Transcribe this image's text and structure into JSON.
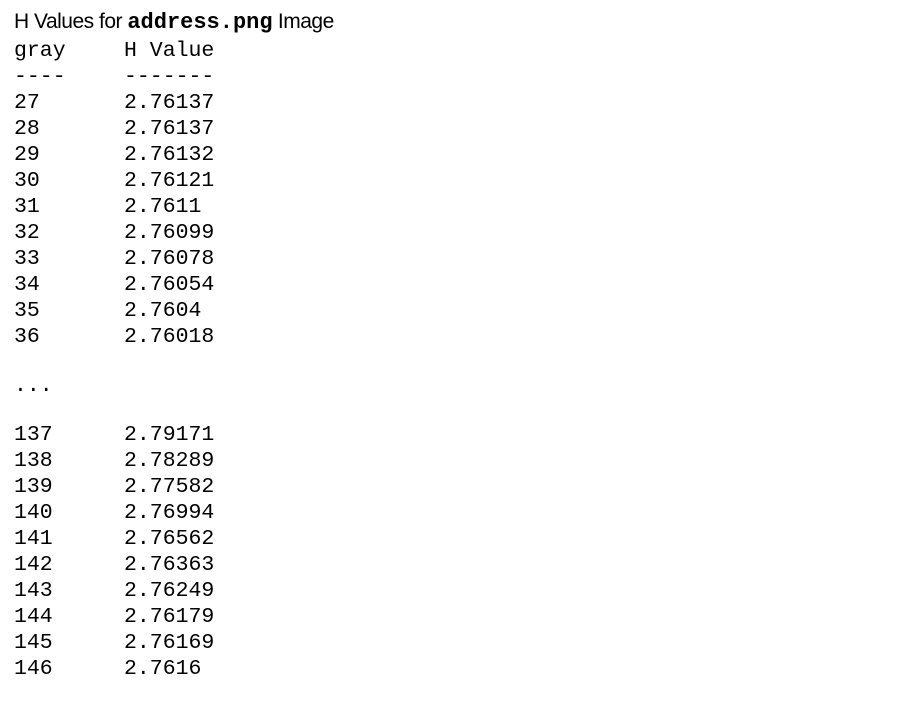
{
  "title": {
    "prefix": "H Values for",
    "filename": "address.png",
    "suffix": "Image"
  },
  "headers": {
    "gray": "gray",
    "h_value": "H Value",
    "gray_rule": "----",
    "h_rule": "-------"
  },
  "rows_top": [
    {
      "gray": "27",
      "h": "2.76137"
    },
    {
      "gray": "28",
      "h": "2.76137"
    },
    {
      "gray": "29",
      "h": "2.76132"
    },
    {
      "gray": "30",
      "h": "2.76121"
    },
    {
      "gray": "31",
      "h": "2.7611"
    },
    {
      "gray": "32",
      "h": "2.76099"
    },
    {
      "gray": "33",
      "h": "2.76078"
    },
    {
      "gray": "34",
      "h": "2.76054"
    },
    {
      "gray": "35",
      "h": "2.7604"
    },
    {
      "gray": "36",
      "h": "2.76018"
    }
  ],
  "ellipsis": "...",
  "rows_bottom": [
    {
      "gray": "137",
      "h": "2.79171"
    },
    {
      "gray": "138",
      "h": "2.78289"
    },
    {
      "gray": "139",
      "h": "2.77582"
    },
    {
      "gray": "140",
      "h": "2.76994"
    },
    {
      "gray": "141",
      "h": "2.76562"
    },
    {
      "gray": "142",
      "h": "2.76363"
    },
    {
      "gray": "143",
      "h": "2.76249"
    },
    {
      "gray": "144",
      "h": "2.76179"
    },
    {
      "gray": "145",
      "h": "2.76169"
    },
    {
      "gray": "146",
      "h": "2.7616"
    }
  ]
}
